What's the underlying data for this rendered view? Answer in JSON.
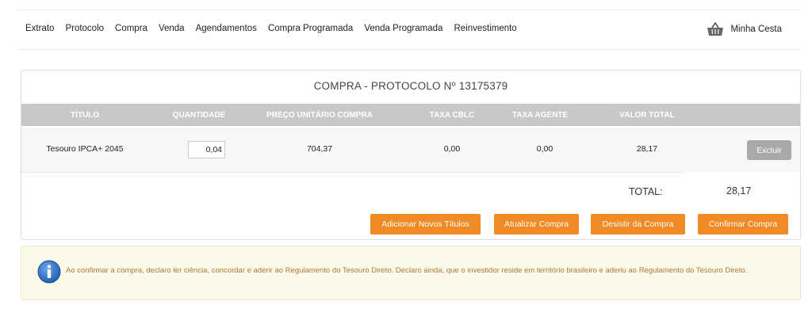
{
  "nav": {
    "items": [
      "Extrato",
      "Protocolo",
      "Compra",
      "Venda",
      "Agendamentos",
      "Compra Programada",
      "Venda Programada",
      "Reinvestimento"
    ],
    "cart_label": "Minha Cesta",
    "cart_icon": "basket-icon"
  },
  "panel": {
    "title": "COMPRA - PROTOCOLO Nº 13175379",
    "columns": [
      "TÍTULO",
      "QUANTIDADE",
      "PREÇO UNITÁRIO COMPRA",
      "TAXA CBLC",
      "TAXA AGENTE",
      "VALOR TOTAL"
    ],
    "row": {
      "titulo": "Tesouro IPCA+ 2045",
      "quantidade": "0,04",
      "preco": "704,37",
      "taxa_cblc": "0,00",
      "taxa_agente": "0,00",
      "valor_total": "28,17",
      "delete_label": "Excluir"
    },
    "total_label": "TOTAL:",
    "total_value": "28,17",
    "buttons": {
      "add": "Adicionar Novos Títulos",
      "update": "Atualizar Compra",
      "cancel": "Desistir da Compra",
      "confirm": "Confirmar Compra"
    }
  },
  "notice": {
    "icon": "info-icon",
    "text": "Ao confirmar a compra, declaro ter ciência, concordar e aderir ao Regulamento do Tesouro Direto. Declaro ainda, que o investidor reside em território brasileiro e aderiu ao Regulamento do Tesouro Direto."
  },
  "colors": {
    "accent": "#f08a24",
    "header_gray": "#c8c8c8",
    "notice_bg": "#fdf9e8",
    "notice_text": "#a77a3b"
  }
}
